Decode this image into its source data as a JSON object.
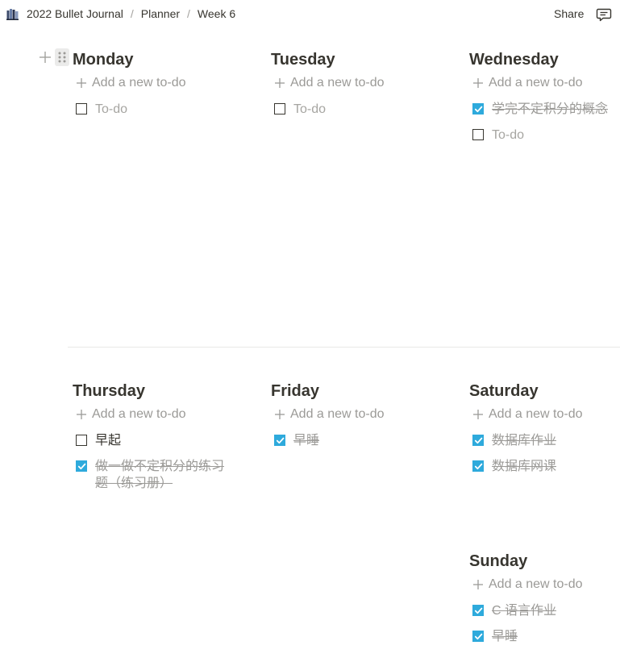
{
  "breadcrumb": {
    "items": [
      "2022 Bullet Journal",
      "Planner",
      "Week 6"
    ],
    "separator": "/"
  },
  "topbar": {
    "share_label": "Share"
  },
  "icons": {
    "page": "book-stack-icon",
    "comment": "comment-icon",
    "plus": "plus-icon",
    "drag": "drag-handle-icon"
  },
  "colors": {
    "checked": "#2eaadc",
    "text": "#37352f",
    "muted": "#9b9a97"
  },
  "add_label": "Add a new to-do",
  "days": [
    {
      "title": "Monday",
      "todos": [
        {
          "text": "To-do",
          "checked": false,
          "placeholder": true
        }
      ]
    },
    {
      "title": "Tuesday",
      "todos": [
        {
          "text": "To-do",
          "checked": false,
          "placeholder": true
        }
      ]
    },
    {
      "title": "Wednesday",
      "todos": [
        {
          "text": "学完不定积分的概念",
          "checked": true,
          "placeholder": false
        },
        {
          "text": "To-do",
          "checked": false,
          "placeholder": true
        }
      ]
    },
    {
      "title": "Thursday",
      "todos": [
        {
          "text": "早起",
          "checked": false,
          "placeholder": false
        },
        {
          "text": "做一做不定积分的练习题（练习册）",
          "checked": true,
          "placeholder": false
        }
      ]
    },
    {
      "title": "Friday",
      "todos": [
        {
          "text": "早睡",
          "checked": true,
          "placeholder": false
        }
      ]
    },
    {
      "title": "Saturday",
      "todos": [
        {
          "text": "数据库作业",
          "checked": true,
          "placeholder": false
        },
        {
          "text": "数据库网课",
          "checked": true,
          "placeholder": false
        }
      ]
    },
    {
      "title": "Sunday",
      "todos": [
        {
          "text": "C 语言作业",
          "checked": true,
          "placeholder": false
        },
        {
          "text": "早睡",
          "checked": true,
          "placeholder": false
        }
      ]
    }
  ]
}
